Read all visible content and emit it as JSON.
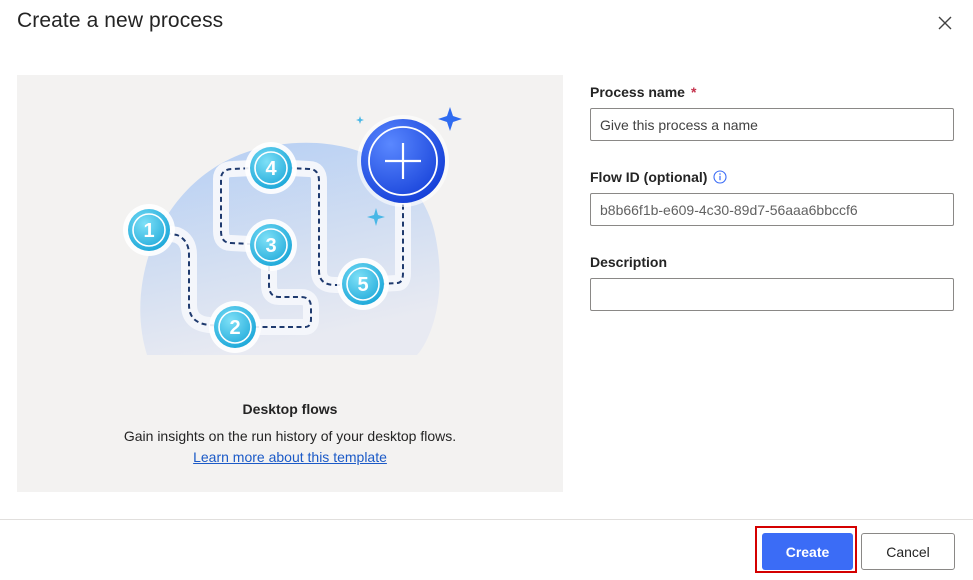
{
  "dialog": {
    "title": "Create a new process"
  },
  "template": {
    "title": "Desktop flows",
    "description": "Gain insights on the run history of your desktop flows.",
    "link_text": "Learn more about this template",
    "steps": [
      "1",
      "2",
      "3",
      "4",
      "5"
    ]
  },
  "form": {
    "process_name": {
      "label": "Process name",
      "required_marker": "*",
      "placeholder": "Give this process a name",
      "value": ""
    },
    "flow_id": {
      "label": "Flow ID (optional)",
      "placeholder": "b8b66f1b-e609-4c30-89d7-56aaa6bbccf6",
      "value": ""
    },
    "description": {
      "label": "Description",
      "value": ""
    }
  },
  "footer": {
    "create_label": "Create",
    "cancel_label": "Cancel"
  },
  "colors": {
    "primary": "#3b6cf6",
    "highlight": "#d40000",
    "link": "#1b5ac7"
  }
}
